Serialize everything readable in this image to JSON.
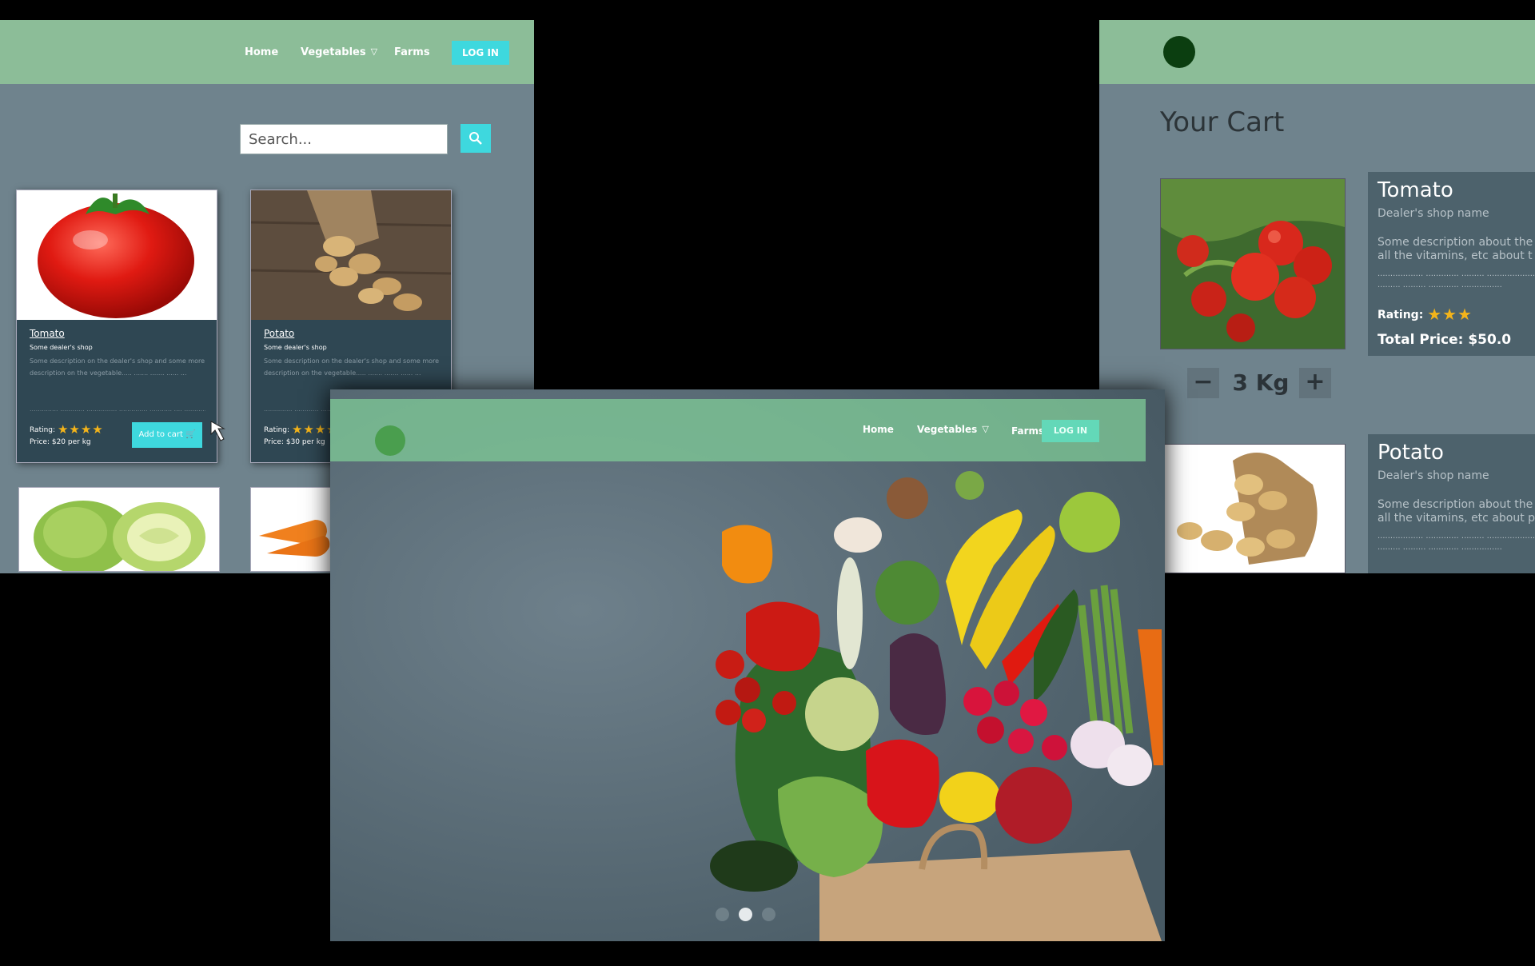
{
  "shop": {
    "nav": {
      "home": "Home",
      "vegetables": "Vegetables",
      "farms": "Farms",
      "login": "LOG IN"
    },
    "search": {
      "placeholder": "Search..."
    },
    "cards": [
      {
        "title": "Tomato",
        "shop": "Some dealer's shop",
        "desc": "Some description on the dealer's shop and some more description on the vegetable..... ....... ....... ...... ...",
        "dots": ".............. ............ ............... .............. ........... .... .............. ....",
        "rating_label": "Rating:",
        "stars": "★★★★",
        "price": "Price: $20 per kg",
        "add": "Add to cart"
      },
      {
        "title": "Potato",
        "shop": "Some dealer's shop",
        "desc": "Some description on the dealer's shop and some more description on the vegetable..... ....... ....... ...... ...",
        "dots": ".............. ............ ............... .............. ........... .... .............. ....",
        "rating_label": "Rating:",
        "stars": "★★★★",
        "price": "Price: $30 per kg"
      }
    ]
  },
  "cart": {
    "title": "Your Cart",
    "items": [
      {
        "name": "Tomato",
        "dealer": "Dealer's shop name",
        "desc1": "Some description about the",
        "desc2": "all the vitamins, etc about t",
        "dots1": ".................. ............. ......... ....................",
        "dots2": "......... ......... ............ ................",
        "rating_label": "Rating:",
        "stars": "★★★",
        "total": "Total Price: $50.0",
        "qty": "3 Kg"
      },
      {
        "name": "Potato",
        "dealer": "Dealer's shop name",
        "desc1": "Some description about the",
        "desc2": "all the vitamins, etc about p",
        "dots1": ".................. ............. ......... ....................",
        "dots2": "......... ......... ............ ................"
      }
    ],
    "minus": "−",
    "plus": "+"
  },
  "hero": {
    "nav": {
      "home": "Home",
      "vegetables": "Vegetables",
      "farms": "Farms",
      "login": "LOG IN"
    },
    "slides": 3,
    "active_slide": 2
  },
  "colors": {
    "nav_green": "#8cbd98",
    "accent_cyan": "#3ed8de",
    "panel_bg": "#6f838d",
    "card_bg": "#2f4753",
    "star": "#f4b41a"
  }
}
